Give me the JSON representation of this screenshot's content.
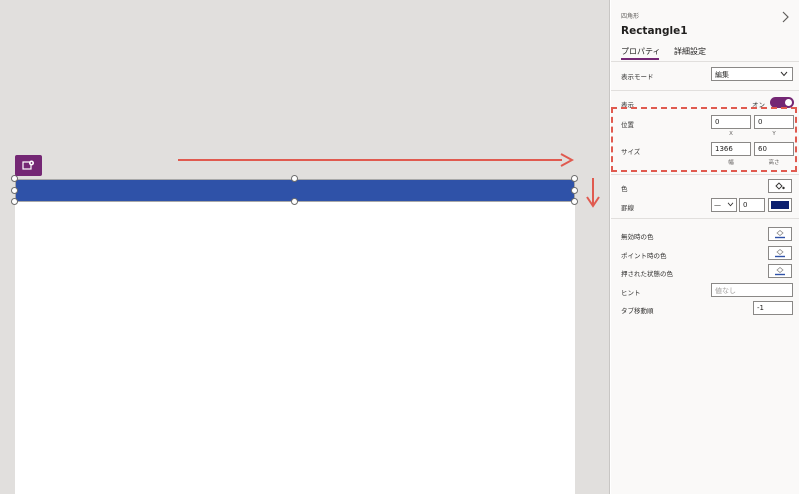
{
  "properties_panel": {
    "control_kind": "四角形",
    "control_name": "Rectangle1",
    "tabs": [
      {
        "label": "プロパティ",
        "active": true
      },
      {
        "label": "詳細設定",
        "active": false
      }
    ],
    "display_mode": {
      "label": "表示モード",
      "value": "編集"
    },
    "visible": {
      "label": "表示",
      "toggle_text": "オン",
      "on": true
    },
    "position": {
      "label": "位置",
      "x": "0",
      "y": "0",
      "x_label": "X",
      "y_label": "Y"
    },
    "size": {
      "label": "サイズ",
      "width": "1366",
      "height": "60",
      "width_label": "幅",
      "height_label": "高さ"
    },
    "fill": {
      "label": "色"
    },
    "border": {
      "label": "罫線",
      "style_value": "—",
      "thickness": "0",
      "color": "#0b1e6e"
    },
    "disabled_color": {
      "label": "無効時の色"
    },
    "hover_color": {
      "label": "ポイント時の色"
    },
    "pressed_color": {
      "label": "押された状態の色"
    },
    "tooltip": {
      "label": "ヒント",
      "placeholder": "値なし"
    },
    "tab_index": {
      "label": "タブ移動順",
      "value": "-1"
    }
  },
  "colors": {
    "accent": "#742774",
    "rectangle_fill": "#2f52a8",
    "annotation_red": "#e05a4f"
  }
}
